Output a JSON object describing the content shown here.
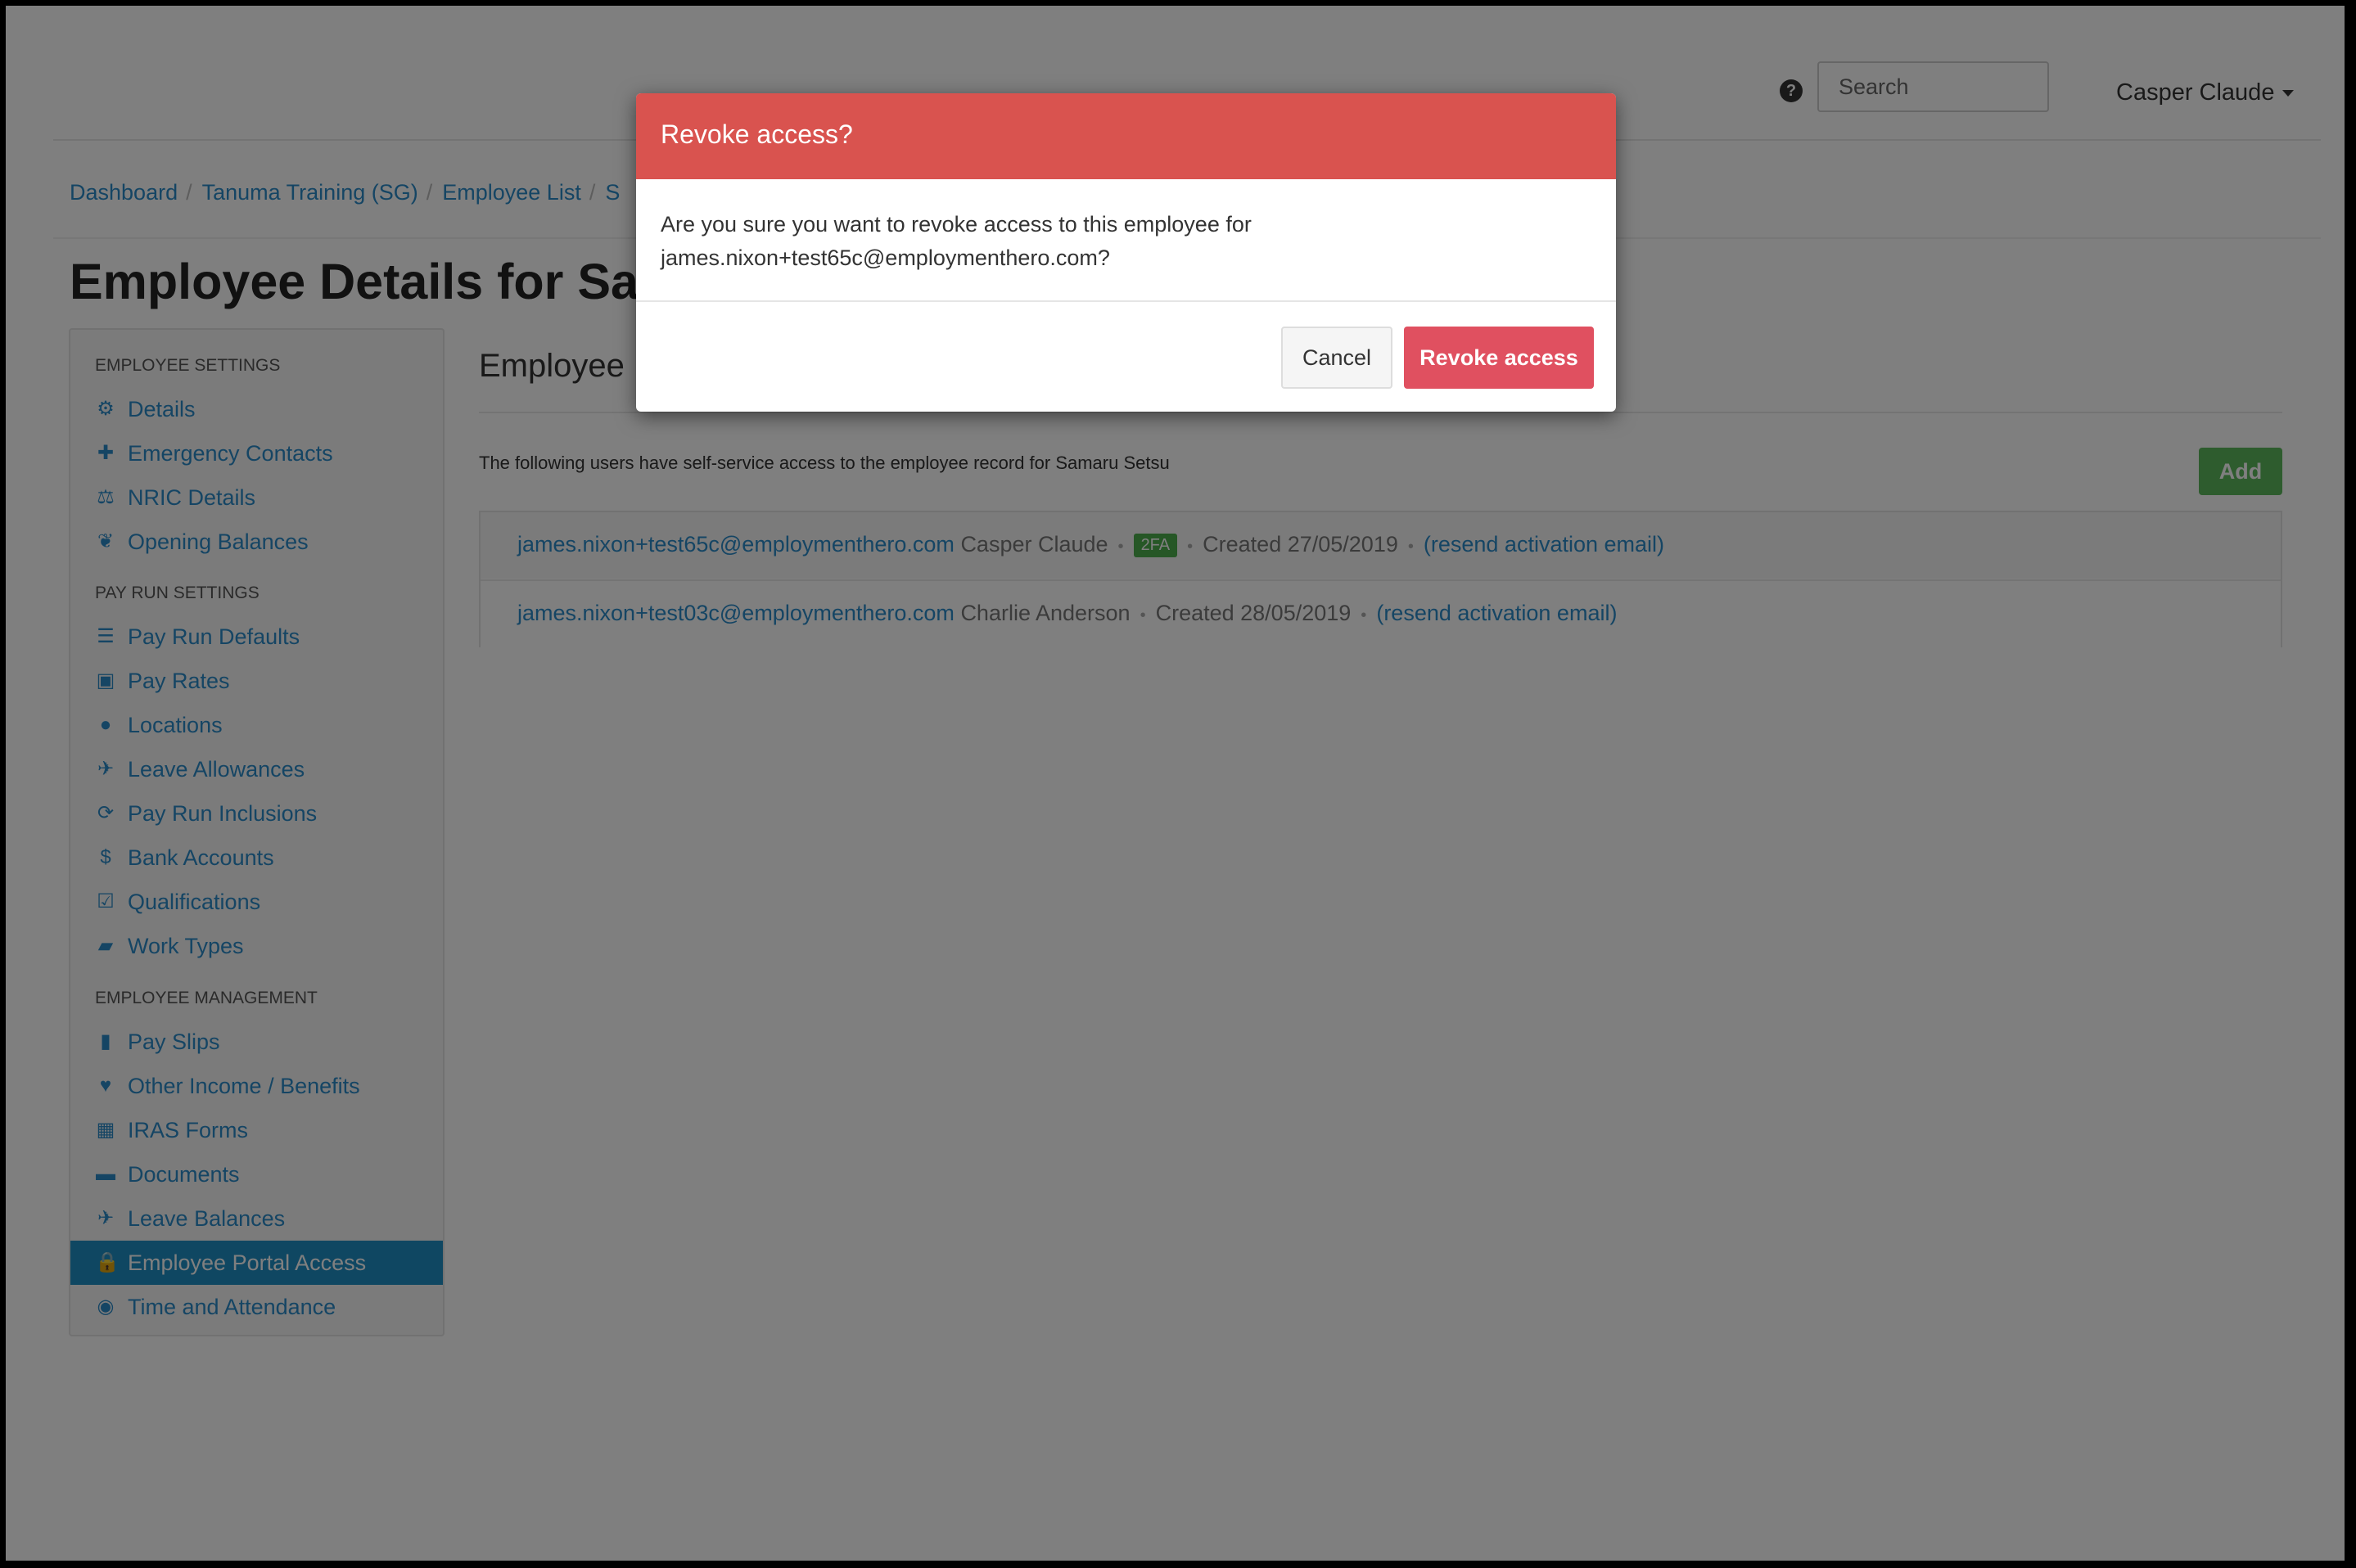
{
  "header": {
    "help_icon": "question-circle-icon",
    "help_glyph": "?",
    "search_placeholder": "Search",
    "user_name": "Casper Claude"
  },
  "breadcrumb": [
    "Dashboard",
    "Tanuma Training (SG)",
    "Employee List",
    "S"
  ],
  "page_title": "Employee Details for Sama",
  "sidebar": {
    "sections": [
      {
        "heading": "EMPLOYEE SETTINGS",
        "items": [
          {
            "label": "Details",
            "icon": "gear-icon",
            "glyph": "⚙"
          },
          {
            "label": "Emergency Contacts",
            "icon": "plus-icon",
            "glyph": "✚"
          },
          {
            "label": "NRIC Details",
            "icon": "balance-scale-icon",
            "glyph": "⚖"
          },
          {
            "label": "Opening Balances",
            "icon": "leaf-icon",
            "glyph": "❦"
          }
        ]
      },
      {
        "heading": "PAY RUN SETTINGS",
        "items": [
          {
            "label": "Pay Run Defaults",
            "icon": "list-icon",
            "glyph": "☰"
          },
          {
            "label": "Pay Rates",
            "icon": "money-icon",
            "glyph": "▣"
          },
          {
            "label": "Locations",
            "icon": "globe-icon",
            "glyph": "●"
          },
          {
            "label": "Leave Allowances",
            "icon": "plane-icon",
            "glyph": "✈"
          },
          {
            "label": "Pay Run Inclusions",
            "icon": "refresh-icon",
            "glyph": "⟳"
          },
          {
            "label": "Bank Accounts",
            "icon": "dollar-circle-icon",
            "glyph": "$"
          },
          {
            "label": "Qualifications",
            "icon": "check-square-icon",
            "glyph": "☑"
          },
          {
            "label": "Work Types",
            "icon": "book-icon",
            "glyph": "▰"
          }
        ]
      },
      {
        "heading": "EMPLOYEE MANAGEMENT",
        "items": [
          {
            "label": "Pay Slips",
            "icon": "file-icon",
            "glyph": "▮"
          },
          {
            "label": "Other Income / Benefits",
            "icon": "hand-holding-icon",
            "glyph": "♥"
          },
          {
            "label": "IRAS Forms",
            "icon": "calculator-icon",
            "glyph": "▦"
          },
          {
            "label": "Documents",
            "icon": "folder-icon",
            "glyph": "▬"
          },
          {
            "label": "Leave Balances",
            "icon": "plane-icon",
            "glyph": "✈"
          },
          {
            "label": "Employee Portal Access",
            "icon": "lock-icon",
            "glyph": "🔒",
            "active": true
          },
          {
            "label": "Time and Attendance",
            "icon": "user-circle-icon",
            "glyph": "◉"
          }
        ]
      }
    ]
  },
  "main": {
    "section_title": "Employee",
    "intro": "The following users have self-service access to the employee record for Samaru Setsu",
    "add_label": "Add",
    "users": [
      {
        "email": "james.nixon+test65c@employmenthero.com",
        "name": "Casper Claude",
        "badge": "2FA",
        "created": "Created 27/05/2019",
        "resend": "resend activation email"
      },
      {
        "email": "james.nixon+test03c@employmenthero.com",
        "name": "Charlie Anderson",
        "badge": "",
        "created": "Created 28/05/2019",
        "resend": "resend activation email"
      }
    ]
  },
  "modal": {
    "title": "Revoke access?",
    "body_line1": "Are you sure you want to revoke access to this employee for",
    "body_line2": "james.nixon+test65c@employmenthero.com?",
    "cancel_label": "Cancel",
    "confirm_label": "Revoke access"
  },
  "colors": {
    "link": "#2a8bc9",
    "active_nav": "#1f8ec5",
    "danger_header": "#d9534f",
    "danger_button": "#e05060",
    "success": "#5cb85c"
  }
}
